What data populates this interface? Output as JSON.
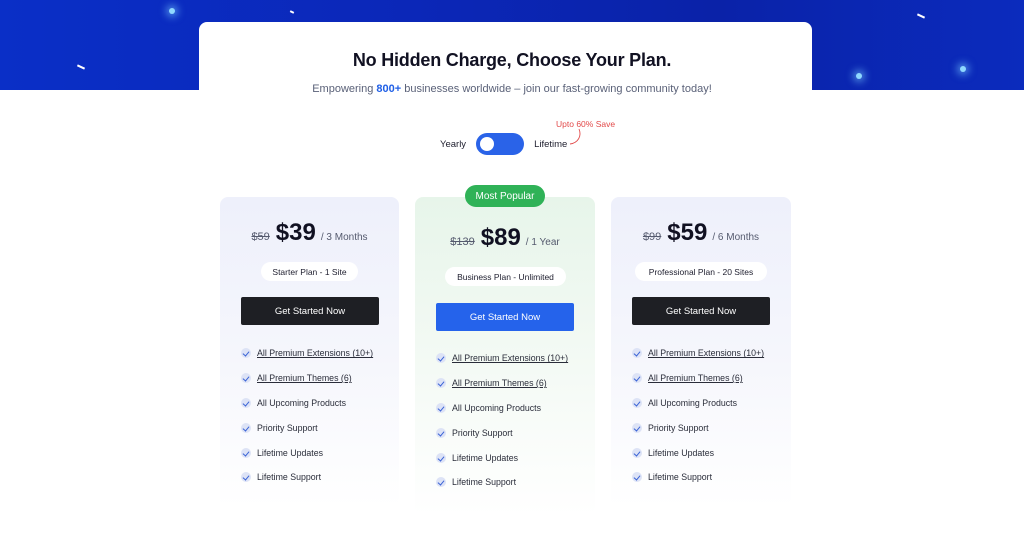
{
  "headline": "No Hidden Charge, Choose Your Plan.",
  "subline": {
    "before": "Empowering ",
    "highlight": "800+",
    "after": " businesses worldwide – join our fast-growing community today!"
  },
  "billing_toggle": {
    "left_label": "Yearly",
    "right_label": "Lifetime",
    "save_note": "Upto 60% Save"
  },
  "colors": {
    "accent_blue": "#2563eb",
    "popular_green": "#2fb257",
    "save_red": "#e24a4a",
    "hero_blue": "#0b27b8"
  },
  "plans": [
    {
      "old_price": "$59",
      "price": "$39",
      "period": "/ 3 Months",
      "plan_name": "Starter Plan - 1 Site",
      "cta": "Get Started Now",
      "features": [
        "All Premium Extensions (10+)",
        "All Premium Themes (6)",
        "All Upcoming Products",
        "Priority Support",
        "Lifetime Updates",
        "Lifetime Support"
      ]
    },
    {
      "badge": "Most Popular",
      "old_price": "$139",
      "price": "$89",
      "period": "/ 1 Year",
      "plan_name": "Business Plan - Unlimited",
      "cta": "Get Started Now",
      "features": [
        "All Premium Extensions (10+)",
        "All Premium Themes (6)",
        "All Upcoming Products",
        "Priority Support",
        "Lifetime Updates",
        "Lifetime Support"
      ]
    },
    {
      "old_price": "$99",
      "price": "$59",
      "period": "/ 6 Months",
      "plan_name": "Professional Plan - 20 Sites",
      "cta": "Get Started Now",
      "features": [
        "All Premium Extensions (10+)",
        "All Premium Themes (6)",
        "All Upcoming Products",
        "Priority Support",
        "Lifetime Updates",
        "Lifetime Support"
      ]
    }
  ]
}
